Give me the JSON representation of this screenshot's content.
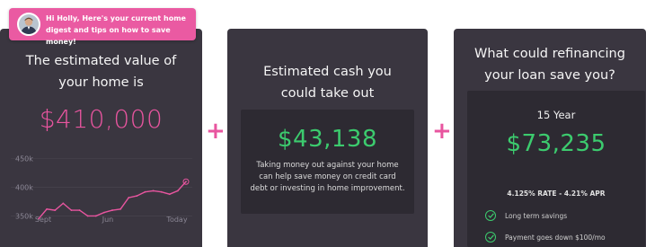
{
  "banner": {
    "message": "Hi Holly, Here's your current home digest and tips on how to save money!"
  },
  "home_value": {
    "title": "The estimated value of your home is",
    "value": "$410,000"
  },
  "cash_out": {
    "title": "Estimated cash you could take out",
    "value": "$43,138",
    "description": "Taking money out against your home can help save money on credit card debt or investing in home improvement."
  },
  "refinance": {
    "title": "What could refinancing your loan save you?",
    "term": "15 Year",
    "value": "$73,235",
    "rate": "4.125% RATE - 4.21% APR",
    "benefits": [
      "Long term savings",
      "Payment goes down $100/mo"
    ]
  },
  "plus_symbol": "+",
  "chart_data": {
    "type": "line",
    "x_tick_labels": [
      "Sept",
      "Jun",
      "Today"
    ],
    "y_tick_labels": [
      "450k",
      "400k",
      "350k"
    ],
    "y_ticks": [
      450,
      400,
      350
    ],
    "ylim": [
      335,
      470
    ],
    "values": [
      345,
      362,
      360,
      372,
      360,
      360,
      350,
      350,
      356,
      360,
      362,
      382,
      385,
      392,
      394,
      392,
      388,
      394,
      410
    ],
    "line_color": "#e8559f"
  }
}
